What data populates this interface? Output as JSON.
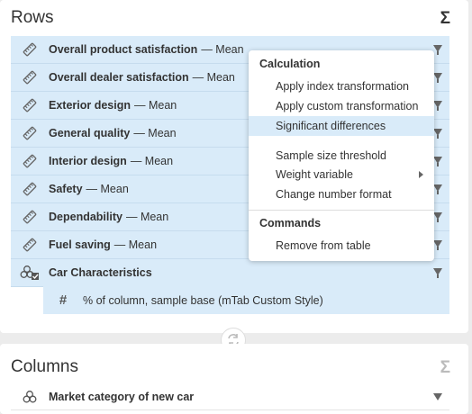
{
  "rows_panel": {
    "title": "Rows",
    "sigma": "Σ",
    "items": [
      {
        "name": "Overall product satisfaction",
        "stat": "— Mean"
      },
      {
        "name": "Overall dealer satisfaction",
        "stat": "— Mean"
      },
      {
        "name": "Exterior design",
        "stat": "— Mean"
      },
      {
        "name": "General quality",
        "stat": "— Mean"
      },
      {
        "name": "Interior design",
        "stat": "— Mean"
      },
      {
        "name": "Safety",
        "stat": "— Mean"
      },
      {
        "name": "Dependability",
        "stat": "— Mean"
      },
      {
        "name": "Fuel saving",
        "stat": "— Mean"
      },
      {
        "name": "Car Characteristics",
        "stat": ""
      }
    ],
    "subrow": {
      "symbol": "#",
      "label": "% of column, sample base (mTab Custom Style)"
    }
  },
  "context_menu": {
    "calc_header": "Calculation",
    "calc_items": [
      "Apply index transformation",
      "Apply custom transformation",
      "Significant differences"
    ],
    "highlighted_item": "Significant differences",
    "other_items": [
      "Sample size threshold",
      "Weight variable",
      "Change number format"
    ],
    "commands_header": "Commands",
    "command_items": [
      "Remove from table"
    ]
  },
  "columns_panel": {
    "title": "Columns",
    "sigma": "Σ",
    "items": [
      {
        "name": "Market category of new car"
      }
    ]
  },
  "colors": {
    "row_bg": "#d9ebf9",
    "highlight": "#d9ebf9",
    "sigma_disabled": "#bbbbbb"
  }
}
